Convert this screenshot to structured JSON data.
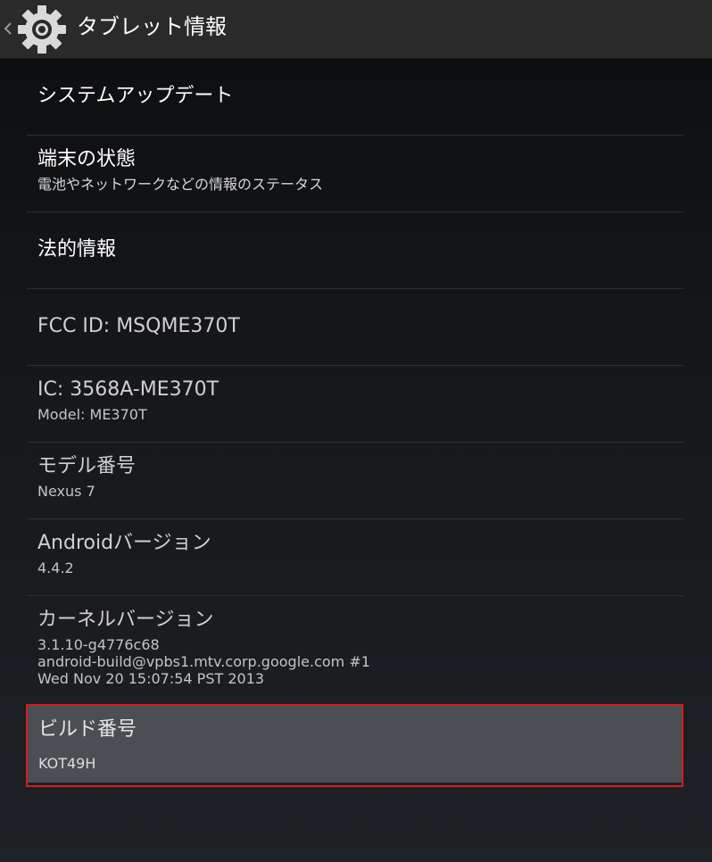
{
  "action_bar": {
    "title": "タブレット情報",
    "up_icon": "chevron-left-icon",
    "app_icon": "gear-icon"
  },
  "items": [
    {
      "title": "システムアップデート"
    },
    {
      "title": "端末の状態",
      "summary": "電池やネットワークなどの情報のステータス"
    },
    {
      "title": "法的情報"
    },
    {
      "title": "FCC ID: MSQME370T"
    },
    {
      "title": "IC: 3568A-ME370T",
      "summary": "Model: ME370T"
    },
    {
      "title": "モデル番号",
      "summary": "Nexus 7"
    },
    {
      "title": "Androidバージョン",
      "summary": "4.4.2"
    },
    {
      "title": "カーネルバージョン",
      "summary_lines": [
        "3.1.10-g4776c68",
        "android-build@vpbs1.mtv.corp.google.com #1",
        "Wed Nov 20 15:07:54 PST 2013"
      ]
    },
    {
      "title": "ビルド番号",
      "summary": "KOT49H"
    }
  ],
  "colors": {
    "background": "#15171a",
    "action_bar": "#2a2a2a",
    "highlight_fill": "#4b4e53",
    "highlight_border": "#d21e1e"
  }
}
